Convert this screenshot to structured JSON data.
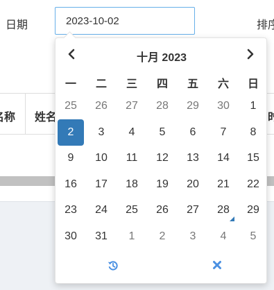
{
  "filter": {
    "date_label": "日期",
    "date_value": "2023-10-02",
    "sort_label": "排序"
  },
  "table": {
    "headers": [
      "名称",
      "姓名",
      "时"
    ]
  },
  "picker": {
    "month_title": "十月 2023",
    "prev_icon": "chevron-left-icon",
    "next_icon": "chevron-right-icon",
    "weekdays": [
      "一",
      "二",
      "三",
      "四",
      "五",
      "六",
      "日"
    ],
    "weeks": [
      [
        {
          "d": "25",
          "m": true
        },
        {
          "d": "26",
          "m": true
        },
        {
          "d": "27",
          "m": true
        },
        {
          "d": "28",
          "m": true
        },
        {
          "d": "29",
          "m": true
        },
        {
          "d": "30",
          "m": true
        },
        {
          "d": "1"
        }
      ],
      [
        {
          "d": "2",
          "sel": true
        },
        {
          "d": "3"
        },
        {
          "d": "4"
        },
        {
          "d": "5"
        },
        {
          "d": "6"
        },
        {
          "d": "7"
        },
        {
          "d": "8"
        }
      ],
      [
        {
          "d": "9"
        },
        {
          "d": "10"
        },
        {
          "d": "11"
        },
        {
          "d": "12"
        },
        {
          "d": "13"
        },
        {
          "d": "14"
        },
        {
          "d": "15"
        }
      ],
      [
        {
          "d": "16"
        },
        {
          "d": "17"
        },
        {
          "d": "18"
        },
        {
          "d": "19"
        },
        {
          "d": "20"
        },
        {
          "d": "21"
        },
        {
          "d": "22"
        }
      ],
      [
        {
          "d": "23"
        },
        {
          "d": "24"
        },
        {
          "d": "25"
        },
        {
          "d": "26"
        },
        {
          "d": "27"
        },
        {
          "d": "28",
          "today": true
        },
        {
          "d": "29"
        }
      ],
      [
        {
          "d": "30"
        },
        {
          "d": "31"
        },
        {
          "d": "1",
          "m": true
        },
        {
          "d": "2",
          "m": true
        },
        {
          "d": "3",
          "m": true
        },
        {
          "d": "4",
          "m": true
        },
        {
          "d": "5",
          "m": true
        }
      ]
    ],
    "reset_icon": "history-reset-icon",
    "clear_icon": "close-icon",
    "accent_color": "#337ab7",
    "icon_color": "#4a90e2"
  }
}
